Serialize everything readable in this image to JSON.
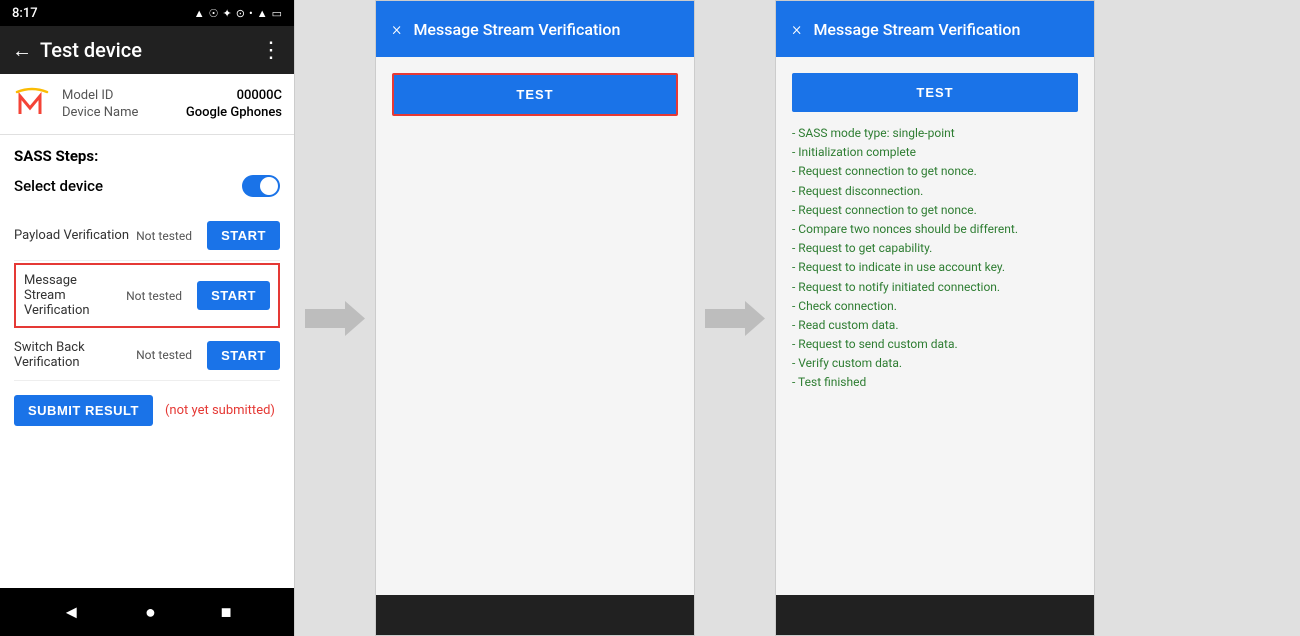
{
  "statusbar": {
    "time": "8:17",
    "icons": "▲ ☉ ✦ ⊙ ●"
  },
  "toolbar": {
    "back_icon": "←",
    "title": "Test device",
    "menu_icon": "⋮"
  },
  "device": {
    "model_id_label": "Model ID",
    "model_id_value": "00000C",
    "device_name_label": "Device Name",
    "device_name_value": "Google Gphones"
  },
  "sass": {
    "title": "SASS Steps:",
    "select_device_label": "Select device"
  },
  "steps": [
    {
      "label": "Payload Verification",
      "status": "Not tested",
      "btn": "START",
      "highlighted": false
    },
    {
      "label": "Message Stream\nVerification",
      "status": "Not tested",
      "btn": "START",
      "highlighted": true
    },
    {
      "label": "Switch Back Verification",
      "status": "Not tested",
      "btn": "START",
      "highlighted": false
    }
  ],
  "submit": {
    "btn_label": "SUBMIT RESULT",
    "status": "(not yet submitted)"
  },
  "navbar": {
    "back": "◄",
    "home": "●",
    "square": "■"
  },
  "dialog1": {
    "title": "Message Stream Verification",
    "close": "×",
    "test_btn": "TEST"
  },
  "dialog2": {
    "title": "Message Stream Verification",
    "close": "×",
    "test_btn": "TEST",
    "log_lines": [
      "- SASS mode type: single-point",
      "- Initialization complete",
      "- Request connection to get nonce.",
      "- Request disconnection.",
      "- Request connection to get nonce.",
      "- Compare two nonces should be different.",
      "- Request to get capability.",
      "- Request to indicate in use account key.",
      "- Request to notify initiated connection.",
      "- Check connection.",
      "- Read custom data.",
      "- Request to send custom data.",
      "- Verify custom data.",
      "- Test finished"
    ]
  }
}
